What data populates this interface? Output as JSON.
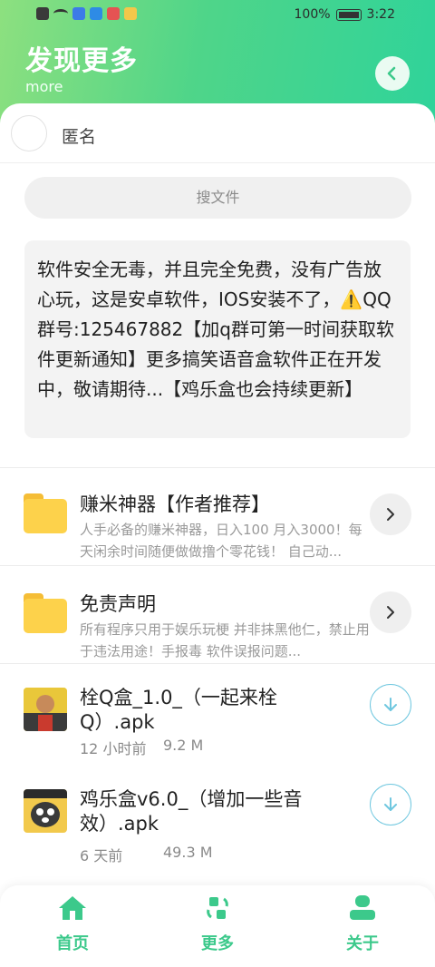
{
  "statusbar": {
    "battery": "100%",
    "time": "3:22"
  },
  "header": {
    "title": "发现更多",
    "subtitle": "more",
    "back_icon": "chevron-left-icon"
  },
  "user": {
    "name": "匿名"
  },
  "search": {
    "placeholder": "搜文件"
  },
  "notice": {
    "text": "软件安全无毒，并且完全免费，没有广告放心玩，这是安卓软件，IOS安装不了，⚠️QQ群号:125467882【加q群可第一时间获取软件更新通知】更多搞笑语音盒软件正在开发中，敬请期待...【鸡乐盒也会持续更新】"
  },
  "folders": [
    {
      "title": "赚米神器【作者推荐】",
      "desc": "人手必备的赚米神器，日入100 月入3000！每天闲余时间随便做做撸个零花钱！     自己动..."
    },
    {
      "title": "免责声明",
      "desc": "所有程序只用于娱乐玩梗 并非抹黑他仁，禁止用于违法用途！手报毒 软件误报问题..."
    }
  ],
  "files": [
    {
      "title": "栓Q盒_1.0_（一起来栓Q）.apk",
      "time": "12 小时前",
      "size": "9.2 M"
    },
    {
      "title": "鸡乐盒v6.0_（增加一些音效）.apk",
      "time": "6 天前",
      "size": "49.3 M"
    }
  ],
  "nav": [
    {
      "label": "首页",
      "icon": "home-icon"
    },
    {
      "label": "更多",
      "icon": "refresh-grid-icon"
    },
    {
      "label": "关于",
      "icon": "user-icon"
    }
  ],
  "colors": {
    "accent": "#3cc98b",
    "header_start": "#8de07f",
    "header_end": "#2fd39a",
    "download": "#6fc7df",
    "folder": "#fdd24b"
  }
}
